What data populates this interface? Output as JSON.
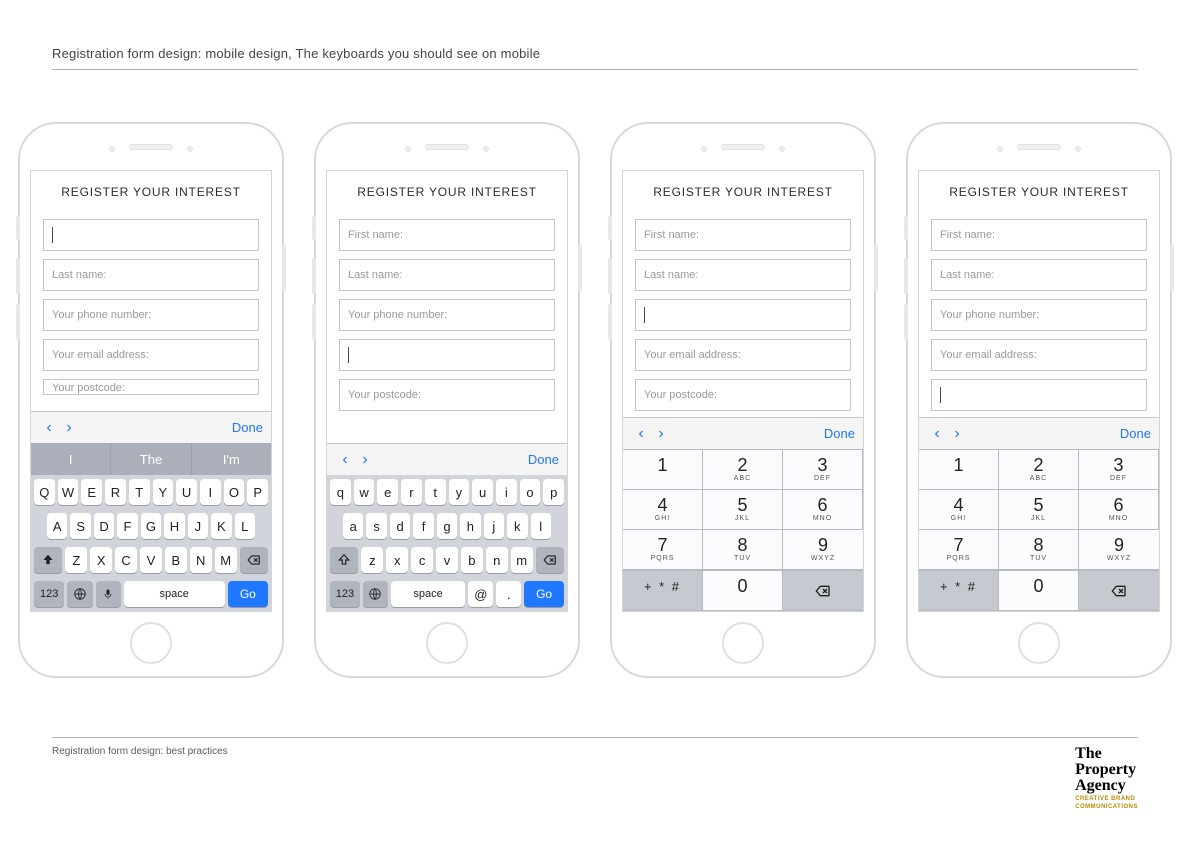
{
  "page": {
    "title": "Registration form design: mobile design, The keyboards you should see on mobile",
    "footer": "Registration form design: best practices"
  },
  "brand": {
    "line1": "The",
    "line2": "Property",
    "line3": "Agency",
    "tag1": "CREATIVE BRAND",
    "tag2": "COMMUNICATIONS"
  },
  "form": {
    "heading": "REGISTER YOUR INTEREST",
    "fields": {
      "first_name": "First name:",
      "last_name": "Last name:",
      "phone": "Your phone number:",
      "email": "Your email address:",
      "postcode": "Your postcode:",
      "postcode_cut": "Your postcode:"
    }
  },
  "kb_toolbar": {
    "prev": "‹",
    "next": "›",
    "done": "Done"
  },
  "kb_qwerty_upper": {
    "sugg": [
      "I",
      "The",
      "I'm"
    ],
    "r1": [
      "Q",
      "W",
      "E",
      "R",
      "T",
      "Y",
      "U",
      "I",
      "O",
      "P"
    ],
    "r2": [
      "A",
      "S",
      "D",
      "F",
      "G",
      "H",
      "J",
      "K",
      "L"
    ],
    "r3": [
      "Z",
      "X",
      "C",
      "V",
      "B",
      "N",
      "M"
    ],
    "num": "123",
    "space": "space",
    "go": "Go"
  },
  "kb_qwerty_lower": {
    "r1": [
      "q",
      "w",
      "e",
      "r",
      "t",
      "y",
      "u",
      "i",
      "o",
      "p"
    ],
    "r2": [
      "a",
      "s",
      "d",
      "f",
      "g",
      "h",
      "j",
      "k",
      "l"
    ],
    "r3": [
      "z",
      "x",
      "c",
      "v",
      "b",
      "n",
      "m"
    ],
    "num": "123",
    "space": "space",
    "at": "@",
    "dot": ".",
    "go": "Go"
  },
  "kb_numeric": {
    "keys": [
      {
        "d": "1",
        "l": ""
      },
      {
        "d": "2",
        "l": "ABC"
      },
      {
        "d": "3",
        "l": "DEF"
      },
      {
        "d": "4",
        "l": "GHI"
      },
      {
        "d": "5",
        "l": "JKL"
      },
      {
        "d": "6",
        "l": "MNO"
      },
      {
        "d": "7",
        "l": "PQRS"
      },
      {
        "d": "8",
        "l": "TUV"
      },
      {
        "d": "9",
        "l": "WXYZ"
      }
    ],
    "sym": "+ * #",
    "zero": "0"
  }
}
